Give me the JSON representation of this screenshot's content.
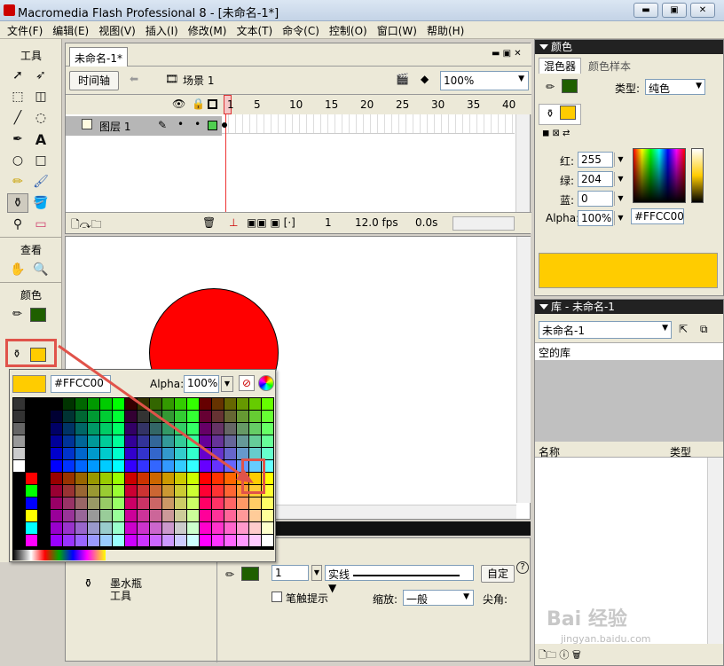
{
  "window": {
    "title": "Macromedia Flash Professional 8 - [未命名-1*]"
  },
  "menu": [
    "文件(F)",
    "编辑(E)",
    "视图(V)",
    "插入(I)",
    "修改(M)",
    "文本(T)",
    "命令(C)",
    "控制(O)",
    "窗口(W)",
    "帮助(H)"
  ],
  "tools": {
    "title": "工具",
    "view_title": "查看",
    "color_title": "颜色"
  },
  "timeline": {
    "doc_tab": "未命名-1*",
    "timeline_button": "时间轴",
    "scene": "场景 1",
    "zoom": "100%",
    "frame_numbers": [
      "1",
      "5",
      "10",
      "15",
      "20",
      "25",
      "30",
      "35",
      "40"
    ],
    "layer_name": "图层 1",
    "current_frame": "1",
    "fps": "12.0 fps",
    "time": "0.0s"
  },
  "swatch_popup": {
    "hex": "#FFCC00",
    "alpha_label": "Alpha:",
    "alpha": "100%"
  },
  "properties": {
    "tool_name_1": "墨水瓶",
    "tool_name_2": "工具",
    "stroke_size": "1",
    "stroke_style": "实线",
    "custom_button": "自定",
    "hint_label": "笔触提示",
    "scale_label": "缩放:",
    "scale_value": "一般",
    "cap_label": "尖角:"
  },
  "color_panel": {
    "title": "颜色",
    "tab_mixer": "混色器",
    "tab_swatches": "颜色样本",
    "type_label": "类型:",
    "type_value": "纯色",
    "red_label": "红:",
    "red": "255",
    "green_label": "绿:",
    "green": "204",
    "blue_label": "蓝:",
    "blue": "0",
    "alpha_label": "Alpha:",
    "alpha": "100%",
    "hex": "#FFCC00"
  },
  "library": {
    "title": "库 - 未命名-1",
    "dropdown": "未命名-1",
    "empty": "空的库",
    "col_name": "名称",
    "col_type": "类型"
  },
  "watermark": {
    "brand": "Bai 经验",
    "url": "jingyan.baidu.com"
  },
  "colors": {
    "fill": "#FFCC00",
    "stroke": "#1F5F00",
    "circle": "#FF0000",
    "highlight": "#E0534A"
  }
}
